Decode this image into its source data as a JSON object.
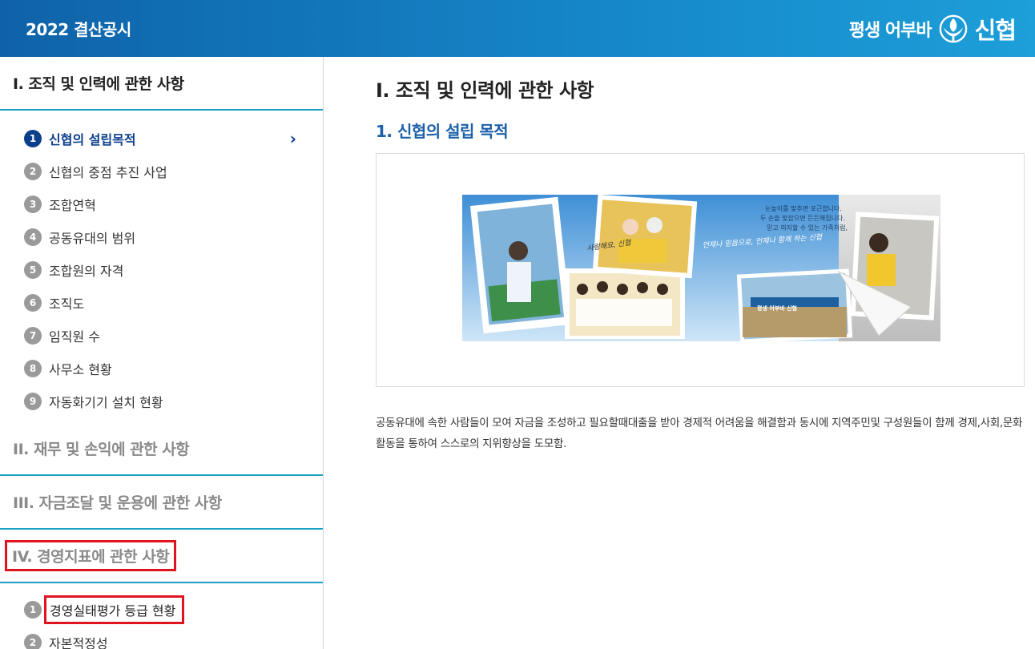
{
  "header": {
    "title": "2022 결산공시",
    "slogan": "평생 어부바",
    "brand_name": "신협"
  },
  "sidebar": {
    "sections": [
      {
        "title": "I. 조직 및 인력에 관한 사항",
        "items": [
          {
            "num": "1",
            "label": "신협의 설립목적"
          },
          {
            "num": "2",
            "label": "신협의 중점 추진 사업"
          },
          {
            "num": "3",
            "label": "조합연혁"
          },
          {
            "num": "4",
            "label": "공동유대의 범위"
          },
          {
            "num": "5",
            "label": "조합원의 자격"
          },
          {
            "num": "6",
            "label": "조직도"
          },
          {
            "num": "7",
            "label": "임직원 수"
          },
          {
            "num": "8",
            "label": "사무소 현황"
          },
          {
            "num": "9",
            "label": "자동화기기 설치 현황"
          }
        ]
      },
      {
        "title": "II. 재무 및 손익에 관한 사항"
      },
      {
        "title": "III. 자금조달 및 운용에 관한 사항"
      },
      {
        "title": "IV. 경영지표에 관한 사항",
        "items": [
          {
            "num": "1",
            "label": "경영실태평가 등급 현황"
          },
          {
            "num": "2",
            "label": "자본적정성"
          }
        ]
      }
    ]
  },
  "main": {
    "page_title": "I. 조직 및 인력에 관한 사항",
    "section_title": "1. 신협의 설립 목적",
    "banner": {
      "caption_lines": [
        "눈높이를 맞추면 포근합니다.",
        "두 손을 맞잡으면 든든해집니다.",
        "믿고 의지할 수 있는 가족처럼,"
      ],
      "handwritten_1": "언제나 믿음으로, 언제나 함께 하는 신협",
      "handwritten_2": "사랑해요, 신협",
      "banner_text": "평생 어부바 신협"
    },
    "description": "공동유대에 속한 사람들이 모여 자금을 조성하고 필요할때대출을 받아 경제적 어려움을 해결함과 동시에 지역주민및 구성원들이 함께 경제,사회,문화활동을 통하여 스스로의 지위향상을 도모함."
  },
  "colors": {
    "header_gradient_start": "#0f62a8",
    "header_gradient_end": "#1d9fd9",
    "active_nav": "#0b3f8c",
    "section_divider": "#1aa0c8",
    "highlight_box": "#e0141e"
  }
}
